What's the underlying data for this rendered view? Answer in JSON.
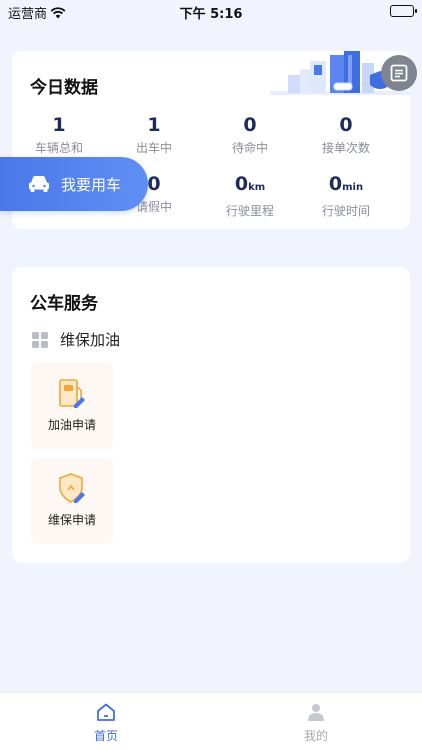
{
  "status_bar": {
    "carrier": "运营商",
    "time": "下午 5:16"
  },
  "stats_card": {
    "title": "今日数据",
    "stats": [
      {
        "value": "1",
        "unit": "",
        "label": "车辆总和"
      },
      {
        "value": "1",
        "unit": "",
        "label": "出车中"
      },
      {
        "value": "0",
        "unit": "",
        "label": "待命中"
      },
      {
        "value": "0",
        "unit": "",
        "label": "接单次数"
      },
      {
        "value": "0",
        "unit": "",
        "label": "请假中"
      },
      {
        "value": "0",
        "unit": "km",
        "label": "行驶里程"
      },
      {
        "value": "0",
        "unit": "min",
        "label": "行驶时间"
      }
    ]
  },
  "use_car_button": {
    "label": "我要用车"
  },
  "service_card": {
    "title": "公车服务",
    "category": "维保加油",
    "tiles": [
      {
        "label": "加油申请",
        "icon": "fuel-request-icon"
      },
      {
        "label": "维保申请",
        "icon": "maintenance-request-icon"
      }
    ]
  },
  "tabbar": {
    "tabs": [
      {
        "label": "首页",
        "icon": "home-icon",
        "active": true
      },
      {
        "label": "我的",
        "icon": "user-icon",
        "active": false
      }
    ]
  },
  "colors": {
    "accent": "#3f6ee3",
    "stat_number": "#1d2b5e",
    "tile_bg": "#fdf8f4",
    "icon_orange": "#f0a83a"
  }
}
